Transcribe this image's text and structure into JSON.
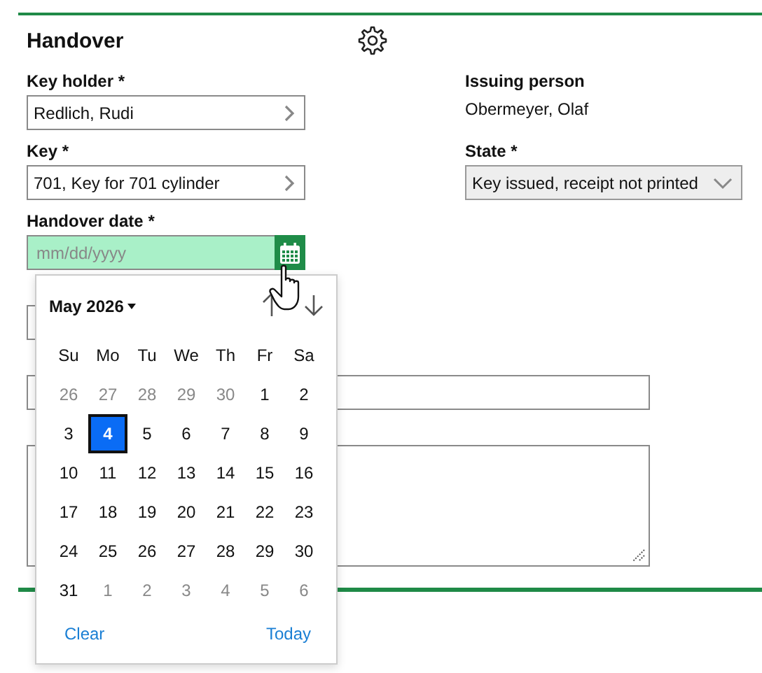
{
  "header": {
    "title": "Handover"
  },
  "left_fields": [
    {
      "kind": "lookup",
      "label": "Key holder *",
      "value": "Redlich, Rudi"
    },
    {
      "kind": "lookup",
      "label": "Key *",
      "value": "701, Key for 701 cylinder"
    },
    {
      "kind": "date",
      "label": "Handover date *",
      "placeholder": "mm/dd/yyyy",
      "focused": true
    }
  ],
  "right_fields": [
    {
      "kind": "text",
      "label": "Issuing person",
      "value": "Obermeyer, Olaf"
    },
    {
      "kind": "select",
      "label": "State *",
      "value": "Key issued, receipt not printed"
    }
  ],
  "lower_fields": [
    {
      "kind": "short"
    },
    {
      "kind": "wide"
    },
    {
      "kind": "textarea"
    }
  ],
  "datepicker": {
    "month": "May 2026",
    "weekdays": [
      "Su",
      "Mo",
      "Tu",
      "We",
      "Th",
      "Fr",
      "Sa"
    ],
    "weeks": [
      [
        {
          "day": "26",
          "outside": true,
          "selected": false
        },
        {
          "day": "27",
          "outside": true,
          "selected": false
        },
        {
          "day": "28",
          "outside": true,
          "selected": false
        },
        {
          "day": "29",
          "outside": true,
          "selected": false
        },
        {
          "day": "30",
          "outside": true,
          "selected": false
        },
        {
          "day": "1",
          "outside": false,
          "selected": false
        },
        {
          "day": "2",
          "outside": false,
          "selected": false
        }
      ],
      [
        {
          "day": "3",
          "outside": false,
          "selected": false
        },
        {
          "day": "4",
          "outside": false,
          "selected": true
        },
        {
          "day": "5",
          "outside": false,
          "selected": false
        },
        {
          "day": "6",
          "outside": false,
          "selected": false
        },
        {
          "day": "7",
          "outside": false,
          "selected": false
        },
        {
          "day": "8",
          "outside": false,
          "selected": false
        },
        {
          "day": "9",
          "outside": false,
          "selected": false
        }
      ],
      [
        {
          "day": "10",
          "outside": false,
          "selected": false
        },
        {
          "day": "11",
          "outside": false,
          "selected": false
        },
        {
          "day": "12",
          "outside": false,
          "selected": false
        },
        {
          "day": "13",
          "outside": false,
          "selected": false
        },
        {
          "day": "14",
          "outside": false,
          "selected": false
        },
        {
          "day": "15",
          "outside": false,
          "selected": false
        },
        {
          "day": "16",
          "outside": false,
          "selected": false
        }
      ],
      [
        {
          "day": "17",
          "outside": false,
          "selected": false
        },
        {
          "day": "18",
          "outside": false,
          "selected": false
        },
        {
          "day": "19",
          "outside": false,
          "selected": false
        },
        {
          "day": "20",
          "outside": false,
          "selected": false
        },
        {
          "day": "21",
          "outside": false,
          "selected": false
        },
        {
          "day": "22",
          "outside": false,
          "selected": false
        },
        {
          "day": "23",
          "outside": false,
          "selected": false
        }
      ],
      [
        {
          "day": "24",
          "outside": false,
          "selected": false
        },
        {
          "day": "25",
          "outside": false,
          "selected": false
        },
        {
          "day": "26",
          "outside": false,
          "selected": false
        },
        {
          "day": "27",
          "outside": false,
          "selected": false
        },
        {
          "day": "28",
          "outside": false,
          "selected": false
        },
        {
          "day": "29",
          "outside": false,
          "selected": false
        },
        {
          "day": "30",
          "outside": false,
          "selected": false
        }
      ],
      [
        {
          "day": "31",
          "outside": false,
          "selected": false
        },
        {
          "day": "1",
          "outside": true,
          "selected": false
        },
        {
          "day": "2",
          "outside": true,
          "selected": false
        },
        {
          "day": "3",
          "outside": true,
          "selected": false
        },
        {
          "day": "4",
          "outside": true,
          "selected": false
        },
        {
          "day": "5",
          "outside": true,
          "selected": false
        },
        {
          "day": "6",
          "outside": true,
          "selected": false
        }
      ]
    ],
    "clear": "Clear",
    "today": "Today"
  }
}
